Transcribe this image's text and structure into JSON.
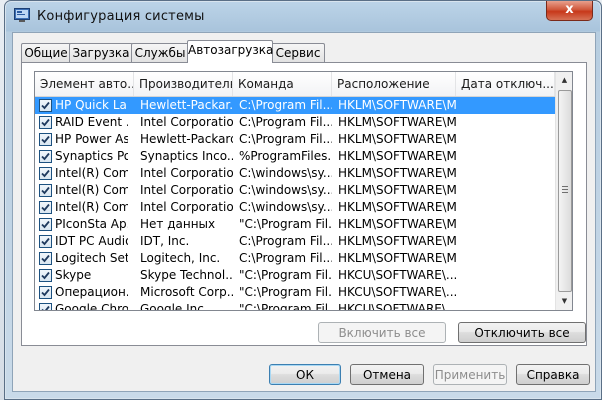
{
  "window": {
    "title": "Конфигурация системы",
    "close_glyph": "x"
  },
  "tabs": [
    {
      "label": "Общие"
    },
    {
      "label": "Загрузка"
    },
    {
      "label": "Службы"
    },
    {
      "label": "Автозагрузка",
      "selected": true
    },
    {
      "label": "Сервис"
    }
  ],
  "columns": [
    "Элемент авто...",
    "Производитель",
    "Команда",
    "Расположение",
    "Дата отключ..."
  ],
  "rows": [
    {
      "checked": true,
      "item": "HP Quick La...",
      "maker": "Hewlett-Packar...",
      "command": "C:\\Program Fil...",
      "location": "HKLM\\SOFTWARE\\M...",
      "date": "",
      "selected": true
    },
    {
      "checked": true,
      "item": "RAID Event ...",
      "maker": "Intel Corporation",
      "command": "C:\\Program Fil...",
      "location": "HKLM\\SOFTWARE\\M...",
      "date": ""
    },
    {
      "checked": true,
      "item": "HP Power As...",
      "maker": "Hewlett-Packard",
      "command": "C:\\Program Fil...",
      "location": "HKLM\\SOFTWARE\\M...",
      "date": ""
    },
    {
      "checked": true,
      "item": "Synaptics Po...",
      "maker": "Synaptics Inco...",
      "command": "%ProgramFiles...",
      "location": "HKLM\\SOFTWARE\\M...",
      "date": ""
    },
    {
      "checked": true,
      "item": "Intel(R) Com...",
      "maker": "Intel Corporation",
      "command": "C:\\windows\\sy...",
      "location": "HKLM\\SOFTWARE\\M...",
      "date": ""
    },
    {
      "checked": true,
      "item": "Intel(R) Com...",
      "maker": "Intel Corporation",
      "command": "C:\\windows\\sy...",
      "location": "HKLM\\SOFTWARE\\M...",
      "date": ""
    },
    {
      "checked": true,
      "item": "Intel(R) Com...",
      "maker": "Intel Corporation",
      "command": "C:\\windows\\sy...",
      "location": "HKLM\\SOFTWARE\\M...",
      "date": ""
    },
    {
      "checked": true,
      "item": "PIconSta Ap...",
      "maker": "Нет данных",
      "command": "\"C:\\Program Fil...",
      "location": "HKLM\\SOFTWARE\\M...",
      "date": ""
    },
    {
      "checked": true,
      "item": "IDT PC Audio",
      "maker": "IDT, Inc.",
      "command": "C:\\Program Fil...",
      "location": "HKLM\\SOFTWARE\\M...",
      "date": ""
    },
    {
      "checked": true,
      "item": "Logitech Set...",
      "maker": "Logitech, Inc.",
      "command": "C:\\Program Fil...",
      "location": "HKLM\\SOFTWARE\\M...",
      "date": ""
    },
    {
      "checked": true,
      "item": "Skype",
      "maker": "Skype Technol...",
      "command": "\"C:\\Program Fil...",
      "location": "HKCU\\SOFTWARE\\...",
      "date": ""
    },
    {
      "checked": true,
      "item": "Операцион...",
      "maker": "Microsoft Corp...",
      "command": "\"C:\\Program Fil...",
      "location": "HKCU\\SOFTWARE\\...",
      "date": ""
    },
    {
      "checked": true,
      "item": "Google Chrome",
      "maker": "Google Inc.",
      "command": "\"C:\\Program Fil...",
      "location": "HKCU\\SOFTWARE\\...",
      "date": ""
    }
  ],
  "panel_buttons": {
    "enable_all": "Включить все",
    "disable_all": "Отключить все"
  },
  "dialog_buttons": {
    "ok": "ОК",
    "cancel": "Отмена",
    "apply": "Применить",
    "help": "Справка"
  },
  "colors": {
    "selection": "#3399ff",
    "close": "#c7381a",
    "frame": "#a9c4dc"
  }
}
